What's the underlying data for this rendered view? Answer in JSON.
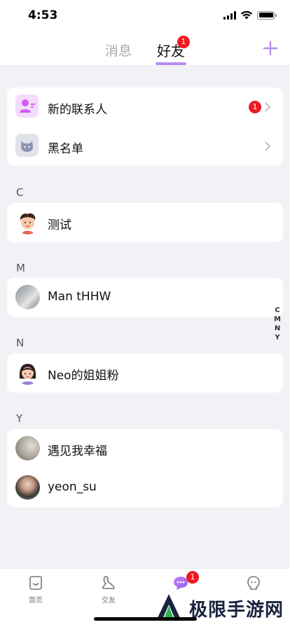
{
  "status_bar": {
    "time": "4:53"
  },
  "header": {
    "tabs": [
      {
        "label": "消息",
        "active": false
      },
      {
        "label": "好友",
        "active": true,
        "badge": "1"
      }
    ],
    "accent": "#b98cf0"
  },
  "top_card": {
    "items": [
      {
        "label": "新的联系人",
        "icon": "new-contact-icon",
        "badge": "1"
      },
      {
        "label": "黑名单",
        "icon": "blacklist-icon"
      }
    ]
  },
  "sections": [
    {
      "letter": "C",
      "contacts": [
        {
          "name": "测试",
          "avatar": "cartoon-boy-avatar"
        }
      ]
    },
    {
      "letter": "M",
      "contacts": [
        {
          "name": "Man tHHW",
          "avatar": "photo-avatar"
        }
      ]
    },
    {
      "letter": "N",
      "contacts": [
        {
          "name": "Neo的姐姐粉",
          "avatar": "cartoon-girl-avatar"
        }
      ]
    },
    {
      "letter": "Y",
      "contacts": [
        {
          "name": "遇见我幸福",
          "avatar": "photo-avatar"
        },
        {
          "name": "yeon_su",
          "avatar": "photo-avatar"
        }
      ]
    }
  ],
  "index_rail": [
    "C",
    "M",
    "N",
    "Y"
  ],
  "tab_bar": {
    "items": [
      {
        "label": "首页",
        "icon": "home-icon"
      },
      {
        "label": "交友",
        "icon": "dating-icon"
      },
      {
        "label": "",
        "icon": "chat-icon",
        "badge": "1",
        "active": true
      },
      {
        "label": "",
        "icon": "profile-icon"
      }
    ]
  },
  "watermark": {
    "text": "极限手游网"
  }
}
